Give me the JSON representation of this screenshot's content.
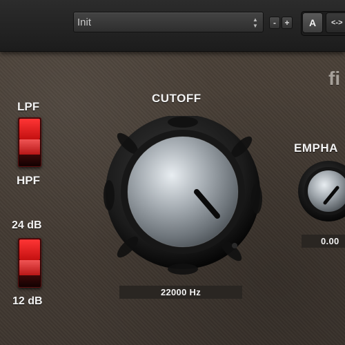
{
  "toolbar": {
    "preset_value": "Init",
    "preset_arrows_icon": "up-down-arrows-icon",
    "decrement_label": "-",
    "increment_label": "+",
    "ab_a_label": "A",
    "ab_copy_label": "<->"
  },
  "brand": {
    "logo_text": "fi"
  },
  "filter_type": {
    "top_label": "LPF",
    "bottom_label": "HPF"
  },
  "slope": {
    "top_label": "24 dB",
    "bottom_label": "12 dB"
  },
  "cutoff": {
    "title": "CUTOFF",
    "readout": "22000 Hz"
  },
  "emphasis": {
    "title": "EMPHA",
    "readout": "0.00"
  },
  "colors": {
    "switch_red": "#e22121",
    "panel_brown": "#4b4239",
    "topbar_dark": "#232323"
  }
}
